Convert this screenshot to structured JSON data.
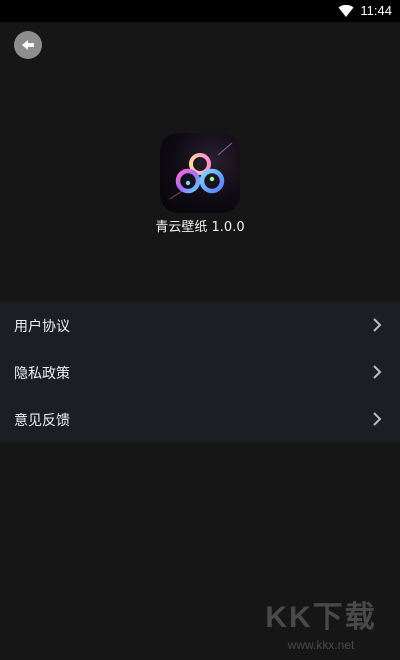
{
  "status_bar": {
    "time": "11:44",
    "wifi_icon": "wifi-icon"
  },
  "header": {
    "back_icon": "back-arrow-icon"
  },
  "app": {
    "icon": "app-logo-icon",
    "name_version": "青云壁纸 1.0.0"
  },
  "menu": {
    "items": [
      {
        "label": "用户协议",
        "icon": "chevron-right-icon"
      },
      {
        "label": "隐私政策",
        "icon": "chevron-right-icon"
      },
      {
        "label": "意见反馈",
        "icon": "chevron-right-icon"
      }
    ]
  },
  "watermark": {
    "logo": "KK下载",
    "url": "www.kkx.net"
  }
}
